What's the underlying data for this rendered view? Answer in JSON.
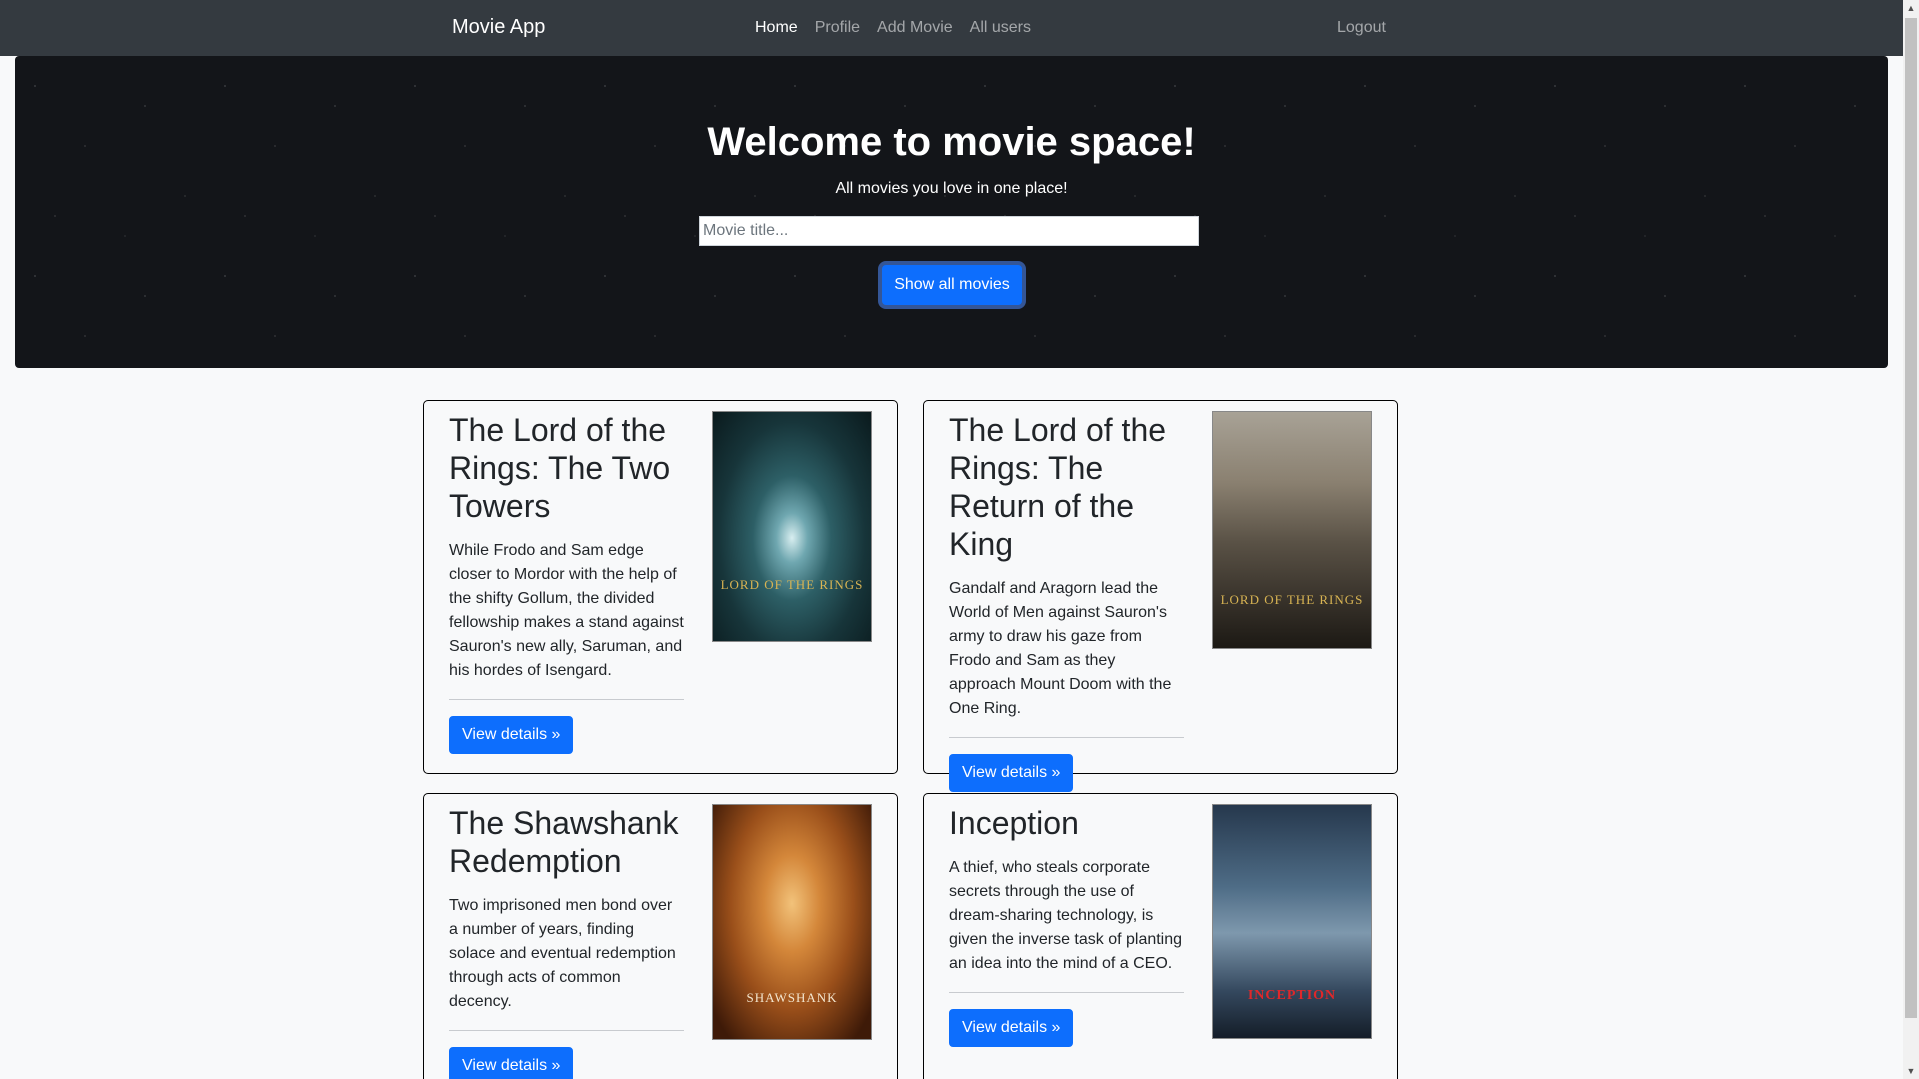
{
  "navbar": {
    "brand": "Movie App",
    "links": [
      "Home",
      "Profile",
      "Add Movie",
      "All users"
    ],
    "logout": "Logout"
  },
  "hero": {
    "title": "Welcome to movie space!",
    "subtitle": "All movies you love in one place!",
    "search_placeholder": "Movie title...",
    "button_label": "Show all movies"
  },
  "movies": [
    {
      "title": "The Lord of the Rings: The Two Towers",
      "description": "While Frodo and Sam edge closer to Mordor with the help of the shifty Gollum, the divided fellowship makes a stand against Sauron's new ally, Saruman, and his hordes of Isengard.",
      "button": "View details »",
      "poster_text": "LORD OF THE RINGS"
    },
    {
      "title": "The Lord of the Rings: The Return of the King",
      "description": "Gandalf and Aragorn lead the World of Men against Sauron's army to draw his gaze from Frodo and Sam as they approach Mount Doom with the One Ring.",
      "button": "View details »",
      "poster_text": "LORD OF THE RINGS"
    },
    {
      "title": "The Shawshank Redemption",
      "description": "Two imprisoned men bond over a number of years, finding solace and eventual redemption through acts of common decency.",
      "button": "View details »",
      "poster_text": "SHAWSHANK"
    },
    {
      "title": "Inception",
      "description": "A thief, who steals corporate secrets through the use of dream-sharing technology, is given the inverse task of planting an idea into the mind of a CEO.",
      "button": "View details »",
      "poster_text": "INCEPTION"
    }
  ],
  "colors": {
    "navbar_bg": "#343a40",
    "primary": "#0d6efd",
    "page_bg": "#f8f9fa"
  }
}
